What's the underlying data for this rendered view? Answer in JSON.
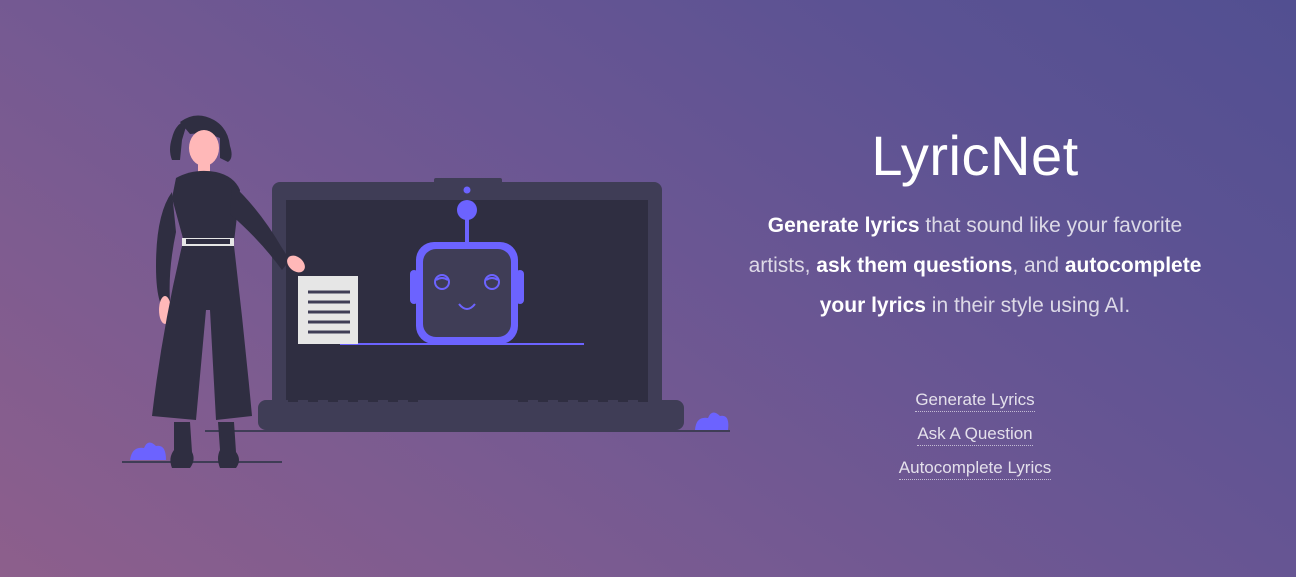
{
  "hero": {
    "title": "LyricNet",
    "tagline": {
      "p1_bold": "Generate lyrics",
      "p2": " that sound like your favorite artists, ",
      "p3_bold": "ask them questions",
      "p4": ", and ",
      "p5_bold": "autocomplete your lyrics",
      "p6": " in their style using AI."
    },
    "links": {
      "generate": "Generate Lyrics",
      "ask": "Ask A Question",
      "autocomplete": "Autocomplete Lyrics"
    }
  },
  "colors": {
    "accent": "#6c63ff",
    "dark": "#3f3d56",
    "screen": "#2f2e41",
    "paper": "#e6e6e6"
  },
  "icons": {
    "illustration": "woman-presenting-robot-on-laptop"
  }
}
